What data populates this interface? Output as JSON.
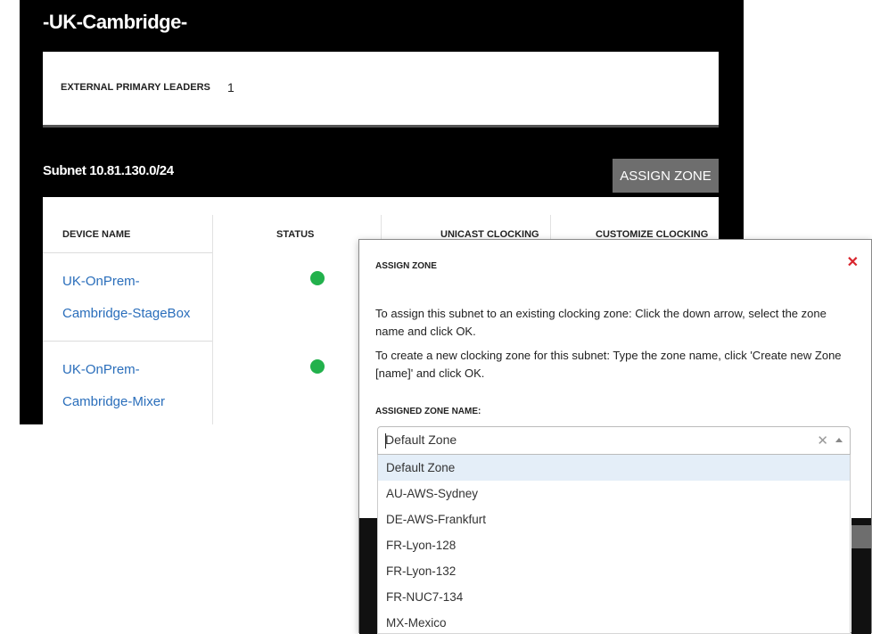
{
  "page": {
    "site_title": "-UK-Cambridge-",
    "external_primary_leaders_label": "EXTERNAL PRIMARY LEADERS",
    "external_primary_leaders_value": "1",
    "subnet_label": "Subnet 10.81.130.0/24",
    "assign_zone_button": "ASSIGN ZONE"
  },
  "table": {
    "columns": [
      "DEVICE NAME",
      "STATUS",
      "UNICAST CLOCKING",
      "CUSTOMIZE CLOCKING"
    ],
    "rows": [
      {
        "name_line1": "UK-OnPrem-",
        "name_line2": "Cambridge-StageBox",
        "status": "online"
      },
      {
        "name_line1": "UK-OnPrem-",
        "name_line2": "Cambridge-Mixer",
        "status": "online"
      }
    ]
  },
  "modal": {
    "title": "ASSIGN ZONE",
    "instructions_1": "To assign this subnet to an existing clocking zone: Click the down arrow, select the zone name and click OK.",
    "instructions_2": "To create a new clocking zone for this subnet: Type the zone name, click 'Create new Zone [name]' and click OK.",
    "field_label": "ASSIGNED ZONE NAME:",
    "zone_value": "Default Zone",
    "zone_options": [
      "Default Zone",
      "AU-AWS-Sydney",
      "DE-AWS-Frankfurt",
      "FR-Lyon-128",
      "FR-Lyon-132",
      "FR-NUC7-134",
      "MX-Mexico"
    ]
  },
  "colors": {
    "link": "#2a6ebb",
    "status_online": "#22b14c",
    "close": "#d9252d",
    "selected_option_bg": "#e4eef8"
  },
  "icons": {
    "close": "close-icon",
    "clear": "clear-icon",
    "dropdown": "chevron-up-icon"
  }
}
